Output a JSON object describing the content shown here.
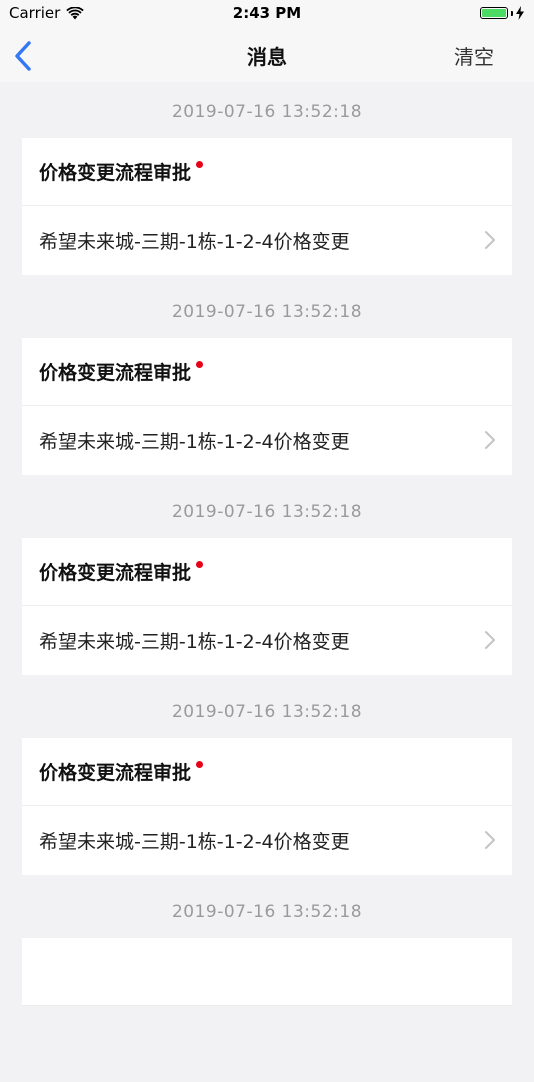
{
  "status_bar": {
    "carrier": "Carrier",
    "time": "2:43 PM"
  },
  "nav": {
    "title": "消息",
    "clear_label": "清空"
  },
  "colors": {
    "back_arrow": "#3478f6",
    "unread_dot": "#e6001a",
    "battery_fill": "#4cd964"
  },
  "messages": [
    {
      "timestamp": "2019-07-16 13:52:18",
      "title": "价格变更流程审批",
      "body": "希望未来城-三期-1栋-1-2-4价格变更",
      "unread": true
    },
    {
      "timestamp": "2019-07-16 13:52:18",
      "title": "价格变更流程审批",
      "body": "希望未来城-三期-1栋-1-2-4价格变更",
      "unread": true
    },
    {
      "timestamp": "2019-07-16 13:52:18",
      "title": "价格变更流程审批",
      "body": "希望未来城-三期-1栋-1-2-4价格变更",
      "unread": true
    },
    {
      "timestamp": "2019-07-16 13:52:18",
      "title": "价格变更流程审批",
      "body": "希望未来城-三期-1栋-1-2-4价格变更",
      "unread": true
    },
    {
      "timestamp": "2019-07-16 13:52:18",
      "title": "",
      "body": "",
      "unread": false
    }
  ]
}
